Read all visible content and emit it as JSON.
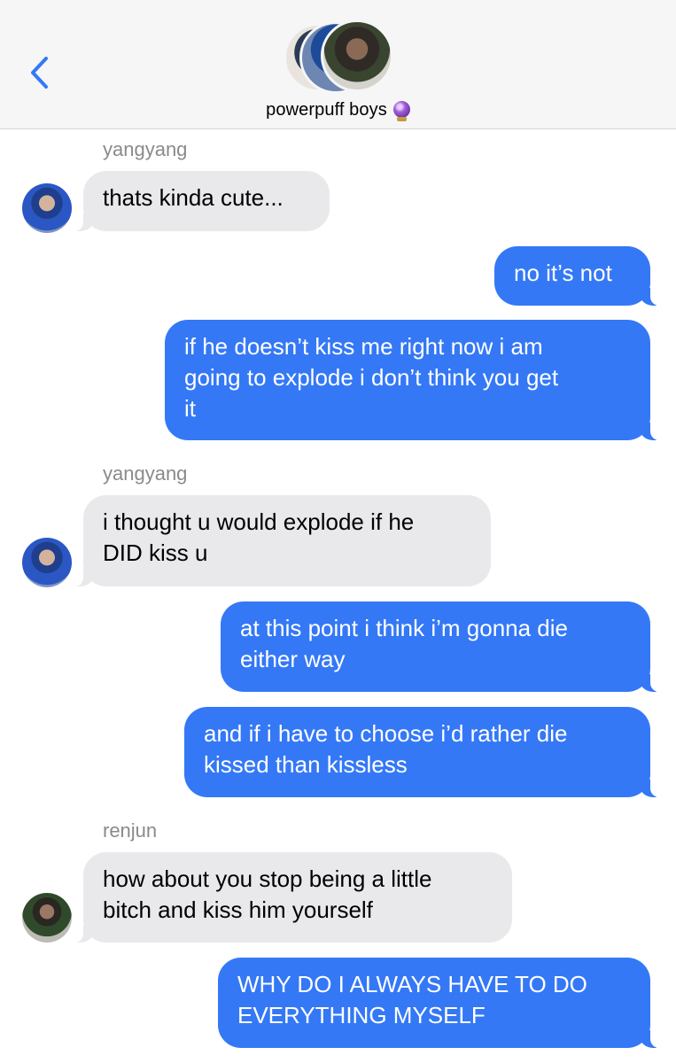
{
  "header": {
    "group_name": "powerpuff boys"
  },
  "messages": [
    {
      "sender": "yangyang",
      "direction": "incoming",
      "lines": [
        "thats kinda cute..."
      ]
    },
    {
      "direction": "outgoing",
      "lines": [
        "no it’s not"
      ]
    },
    {
      "direction": "outgoing",
      "lines": [
        "if he doesn’t kiss me right now i am",
        "going to explode i don’t think you get",
        "it"
      ]
    },
    {
      "sender": "yangyang",
      "direction": "incoming",
      "lines": [
        "i thought u would explode if he",
        "DID kiss u"
      ]
    },
    {
      "direction": "outgoing",
      "lines": [
        "at this point i think i’m gonna die",
        "either way"
      ]
    },
    {
      "direction": "outgoing",
      "lines": [
        "and if i have to choose i’d rather die",
        "kissed than kissless"
      ]
    },
    {
      "sender": "renjun",
      "direction": "incoming",
      "lines": [
        "how about you stop being a little",
        "bitch and kiss him yourself"
      ]
    },
    {
      "direction": "outgoing",
      "lines": [
        "WHY DO I ALWAYS HAVE TO DO",
        "EVERYTHING MYSELF"
      ]
    }
  ],
  "colors": {
    "outgoing_bubble": "#3478f6",
    "incoming_bubble": "#e9e9eb",
    "back_chevron": "#3478f6"
  },
  "icons": {
    "back": "chevron-left-icon",
    "group_emoji": "crystal-ball-icon"
  }
}
